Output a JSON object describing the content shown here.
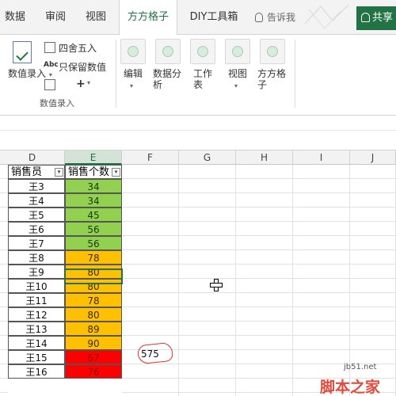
{
  "ribbon_tabs": [
    "数据",
    "审阅",
    "视图",
    "方方格子",
    "DIY工具箱"
  ],
  "tell_me": "告诉我",
  "share": "共享",
  "ribbon": {
    "input_big_button": "数值录入",
    "round_label": "四舍五入",
    "keep_values_label": "只保留数值",
    "group_title": "数值录入",
    "edit_label": "编辑",
    "analysis_label": "数据分析",
    "worksheet_label": "工作表",
    "view_label": "视图",
    "ffgz_label": "方方格子"
  },
  "sheet": {
    "columns": [
      "D",
      "E",
      "F",
      "G",
      "H",
      "I",
      "J"
    ],
    "header_d": "销售员",
    "header_e": "销售个数",
    "names": [
      "王3",
      "王4",
      "王5",
      "王6",
      "王7",
      "王8",
      "王9",
      "王10",
      "王11",
      "王12",
      "王13",
      "王14",
      "王15",
      "王16"
    ],
    "values": [
      "34",
      "34",
      "45",
      "56",
      "56",
      "78",
      "80",
      "80",
      "78",
      "80",
      "89",
      "90",
      "67",
      "76"
    ],
    "value_colors": [
      "#92d050",
      "#92d050",
      "#92d050",
      "#92d050",
      "#92d050",
      "#ffc000",
      "#ffc000",
      "#ffc000",
      "#ffc000",
      "#ffc000",
      "#ffc000",
      "#ffc000",
      "#ff0000",
      "#ff0000"
    ],
    "value_text_colors": [
      "#1a3a0a",
      "#1a3a0a",
      "#1a3a0a",
      "#1a3a0a",
      "#1a3a0a",
      "#3a2a00",
      "#3a2a00",
      "#3a2a00",
      "#3a2a00",
      "#3a2a00",
      "#3a2a00",
      "#3a2a00",
      "#8b0000",
      "#8b0000"
    ],
    "sum_value": "575"
  },
  "watermark": {
    "site": "jb51.net",
    "brand": "脚本之家"
  },
  "colors": {
    "accent": "#217346"
  }
}
